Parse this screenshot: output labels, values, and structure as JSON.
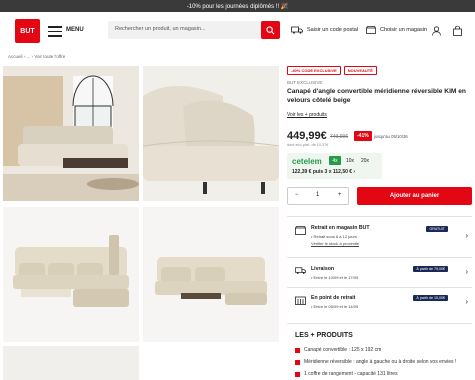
{
  "promo_text": "-10% pour les journées diplômés !! 🎉",
  "header": {
    "logo": "BUT",
    "menu_label": "MENU",
    "search_placeholder": "Rechercher un produit, un magasin...",
    "postal_label": "Saisir un code postal",
    "store_label": "Choisir un magasin"
  },
  "breadcrumb": "Accueil  ›  ...  ›  Voir toute l'offre",
  "product": {
    "badges": [
      "-40% CODE EXCLUSIVE",
      "NOUVEAUTÉ"
    ],
    "exclusive": "BUT EXCLUSIVE",
    "title": "Canapé d'angle convertible méridienne réversible KIM en velours côtelé beige",
    "more_link": "Voir les + produits",
    "price": "449,99€",
    "old_price": "749,99€",
    "discount": "-41%",
    "until": "jusqu'au 05/10/36",
    "eco": "dont éco-part. de 10,37€",
    "financing": {
      "brand": "cetelem",
      "options": [
        "4x",
        "10x",
        "20x"
      ],
      "line": "122,39 € puis 3 x 112,50 € ›"
    },
    "quantity": "1",
    "add_to_cart": "Ajouter au panier"
  },
  "delivery": [
    {
      "title": "Retrait en magasin BUT",
      "line1": "• Retrait sous 6 à 12 jours",
      "line2": "Vérifier le stock à proximité",
      "tag": "GRATUIT"
    },
    {
      "title": "Livraison",
      "line1": "• Entre le 10/09 et le 17/09",
      "line2": "",
      "tag": "À partir de 79,00€"
    },
    {
      "title": "En point de retrait",
      "line1": "• Entre le 05/09 et le 14/09",
      "line2": "",
      "tag": "À partir de 15,00€"
    }
  ],
  "plus": {
    "heading": "LES + PRODUITS",
    "items": [
      "Canapé convertible : 125 x 192 cm",
      "Méridienne réversible : angle à gauche ou à droite selon vos envies !",
      "1 coffre de rangement - capacité 131 litres"
    ]
  },
  "colors": {
    "brand_red": "#e30613",
    "cetelem_green": "#27994a",
    "navy": "#1a2a55"
  }
}
